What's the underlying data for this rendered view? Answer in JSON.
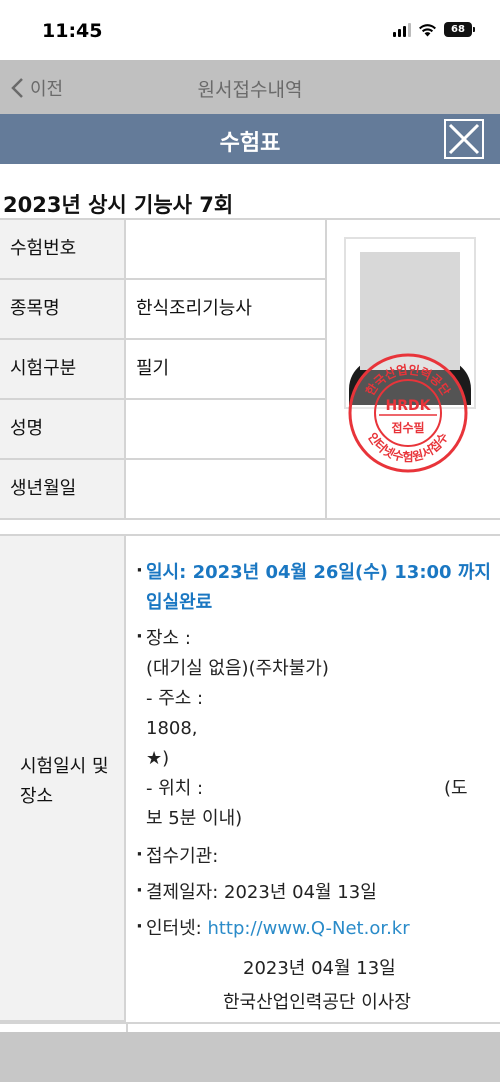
{
  "status_bar": {
    "time": "11:45",
    "battery": "68"
  },
  "app_header": {
    "back_label": "이전",
    "title": "원서접수내역"
  },
  "modal": {
    "title": "수험표",
    "exam_title": "2023년 상시 기능사 7회",
    "info_rows": [
      {
        "label": "수험번호",
        "value": ""
      },
      {
        "label": "종목명",
        "value": "한식조리기능사"
      },
      {
        "label": "시험구분",
        "value": "필기"
      },
      {
        "label": "성명",
        "value": ""
      },
      {
        "label": "생년월일",
        "value": ""
      }
    ],
    "stamp": {
      "logo": "HRDK",
      "center": "접수필",
      "ring_top": "한국산업인력공단",
      "ring_bottom": "인터넷수험원서접수"
    },
    "schedule": {
      "label_line1": "시험일시 및",
      "label_line2": "장소",
      "datetime_line1": "일시: 2023년 04월 26일(수) 13:00 까지",
      "datetime_line2": "입실완료",
      "place_label": "장소 :",
      "place_value": "(대기실 없음)(주차불가)",
      "address_label": "- 주소 :",
      "address_value_partial": "1808, ",
      "address_tail": "★)",
      "location_label": "- 위치 :",
      "location_tail": "(도",
      "location_line2": "보 5분 이내)",
      "receiving_org": "접수기관:",
      "payment_date": "결제일자: 2023년 04월 13일",
      "internet_label": "인터넷: ",
      "internet_url": "http://www.Q-Net.or.kr",
      "issue_date": "2023년 04월 13일",
      "issuer": "한국산업인력공단 이사장"
    }
  },
  "colors": {
    "modal_header": "#647b99",
    "stamp_red": "#e8343a",
    "accent_blue": "#1a77c2",
    "link_blue": "#2a8bc9"
  }
}
